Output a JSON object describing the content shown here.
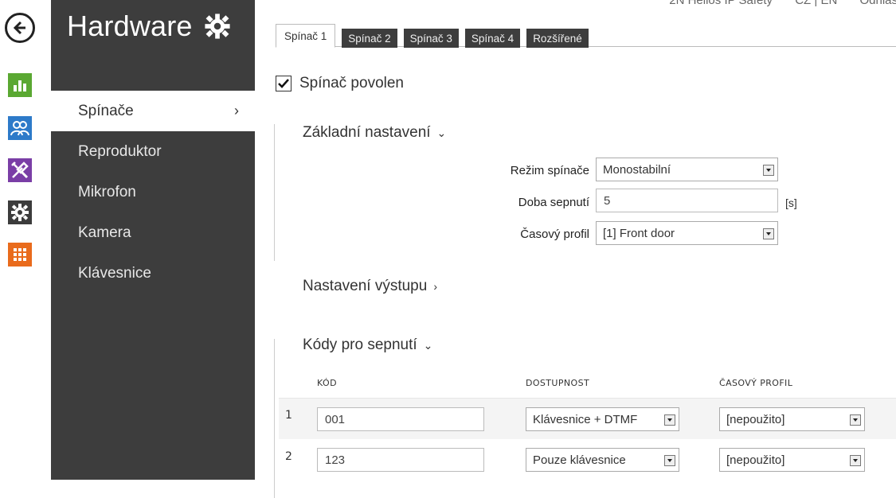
{
  "top_meta": {
    "device": "2N Helios IP Safety",
    "language": "CZ | EN",
    "logout": "Odhlás"
  },
  "rail": {
    "icons": [
      "back-arrow-icon",
      "status-chart-icon",
      "users-icon",
      "services-tools-icon",
      "hardware-gear-icon",
      "system-grid-icon"
    ]
  },
  "sidebar": {
    "title": "Hardware",
    "items": [
      {
        "label": "Spínače",
        "active": true
      },
      {
        "label": "Reproduktor"
      },
      {
        "label": "Mikrofon"
      },
      {
        "label": "Kamera"
      },
      {
        "label": "Klávesnice"
      }
    ]
  },
  "tabs": [
    "Spínač 1",
    "Spínač 2",
    "Spínač 3",
    "Spínač 4",
    "Rozšířené"
  ],
  "switch_enabled": {
    "label": "Spínač povolen",
    "checked": true
  },
  "basic": {
    "title": "Základní nastavení",
    "mode_label": "Režim spínače",
    "mode_value": "Monostabilní",
    "duration_label": "Doba sepnutí",
    "duration_value": "5",
    "duration_unit": "[s]",
    "profile_label": "Časový profil",
    "profile_value": "[1] Front door"
  },
  "output": {
    "title": "Nastavení výstupu"
  },
  "codes": {
    "title": "Kódy pro sepnutí",
    "headers": {
      "code": "KÓD",
      "availability": "DOSTUPNOST",
      "profile": "ČASOVÝ PROFIL"
    },
    "rows": [
      {
        "index": "1",
        "code": "001",
        "availability": "Klávesnice + DTMF",
        "profile": "[nepoužito]"
      },
      {
        "index": "2",
        "code": "123",
        "availability": "Pouze klávesnice",
        "profile": "[nepoužito]"
      }
    ]
  },
  "colors": {
    "sidebar": "#3d3d3d",
    "status": "#5aa832",
    "users": "#2d7ac9",
    "services": "#7a3ea6",
    "system": "#e96b1c"
  }
}
